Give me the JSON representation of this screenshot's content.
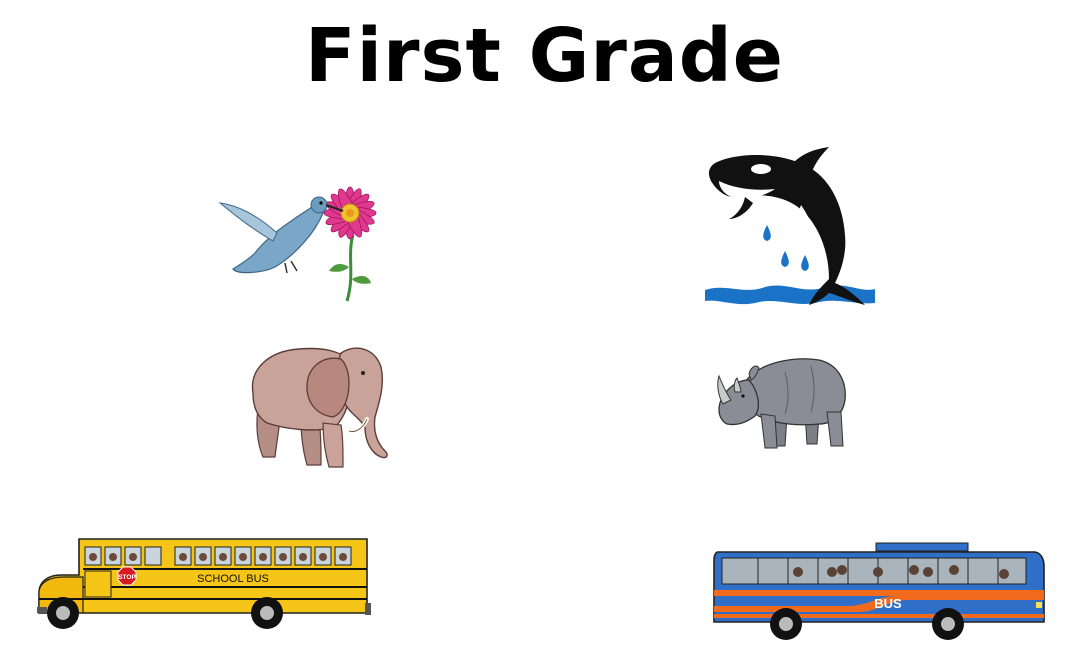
{
  "page": {
    "title": "First Grade"
  },
  "pictures": {
    "hummingbird": {
      "icon": "hummingbird-flower-icon"
    },
    "orca": {
      "icon": "orca-jumping-icon"
    },
    "elephant": {
      "icon": "elephant-icon"
    },
    "rhino": {
      "icon": "rhinoceros-icon"
    },
    "school_bus": {
      "icon": "school-bus-icon",
      "label": "SCHOOL BUS",
      "sign": "STOP"
    },
    "city_bus": {
      "icon": "city-bus-icon",
      "label": "BUS"
    }
  },
  "colors": {
    "school_bus_yellow": "#f5c518",
    "city_bus_blue": "#2f6fc7",
    "city_bus_orange": "#f26b1d",
    "flower_pink": "#e0388f",
    "bird_blue": "#7aa7c7",
    "elephant": "#c9a39a",
    "rhino": "#8a8d96",
    "water": "#1a73c7"
  }
}
